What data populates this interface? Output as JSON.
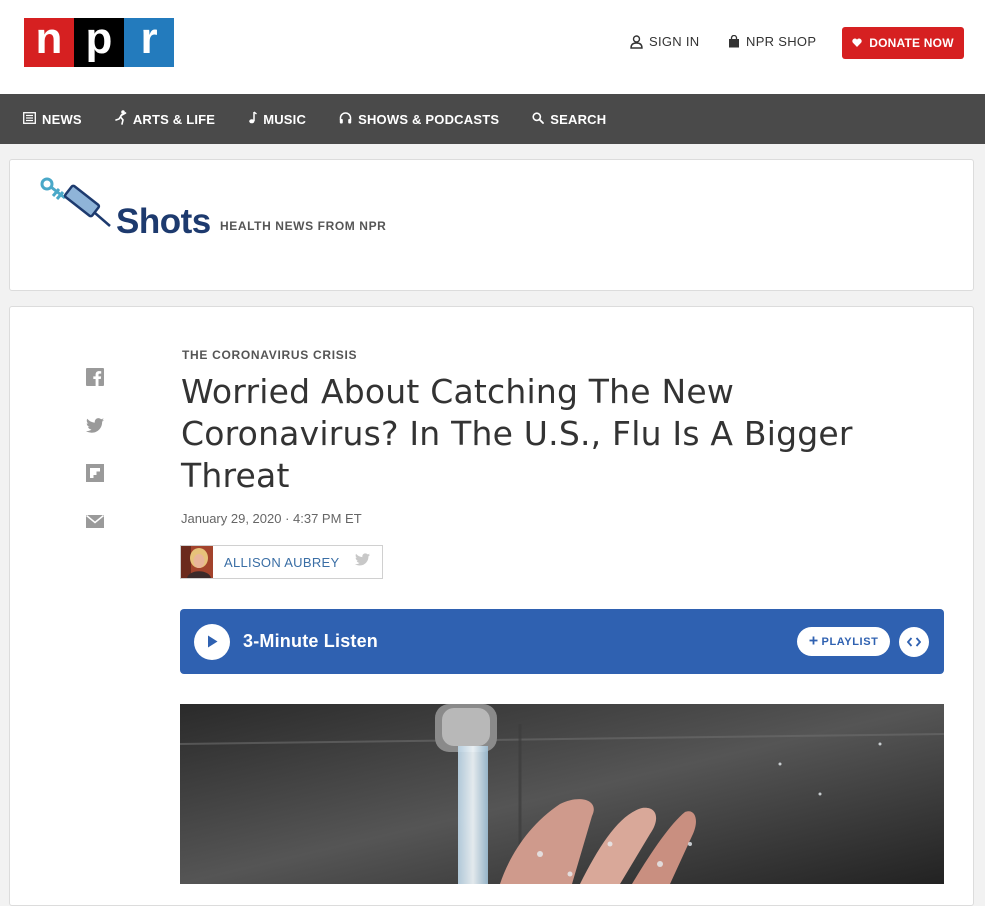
{
  "header": {
    "logo": {
      "n": "n",
      "p": "p",
      "r": "r"
    },
    "sign_in": "SIGN IN",
    "shop": "NPR SHOP",
    "donate": "DONATE NOW"
  },
  "nav": {
    "items": [
      {
        "label": "NEWS",
        "icon": "news-icon"
      },
      {
        "label": "ARTS & LIFE",
        "icon": "arts-icon"
      },
      {
        "label": "MUSIC",
        "icon": "music-icon"
      },
      {
        "label": "SHOWS & PODCASTS",
        "icon": "headphones-icon"
      },
      {
        "label": "SEARCH",
        "icon": "search-icon"
      }
    ]
  },
  "brand": {
    "name": "Shots",
    "tagline": "HEALTH NEWS FROM NPR"
  },
  "article": {
    "kicker": "THE CORONAVIRUS CRISIS",
    "headline": "Worried About Catching The New Coronavirus? In The U.S., Flu Is A Bigger Threat",
    "date": "January 29, 2020 · 4:37 PM ET",
    "author": "ALLISON AUBREY",
    "listen_label": "3-Minute Listen",
    "playlist_label": "PLAYLIST",
    "share_icons": [
      "facebook-icon",
      "twitter-icon",
      "flipboard-icon",
      "email-icon"
    ]
  },
  "colors": {
    "npr_red": "#d62021",
    "npr_blue": "#237bbd",
    "nav_bg": "#4a4a4a",
    "listen_bg": "#2f61b1",
    "shots_navy": "#1d3a6e"
  }
}
